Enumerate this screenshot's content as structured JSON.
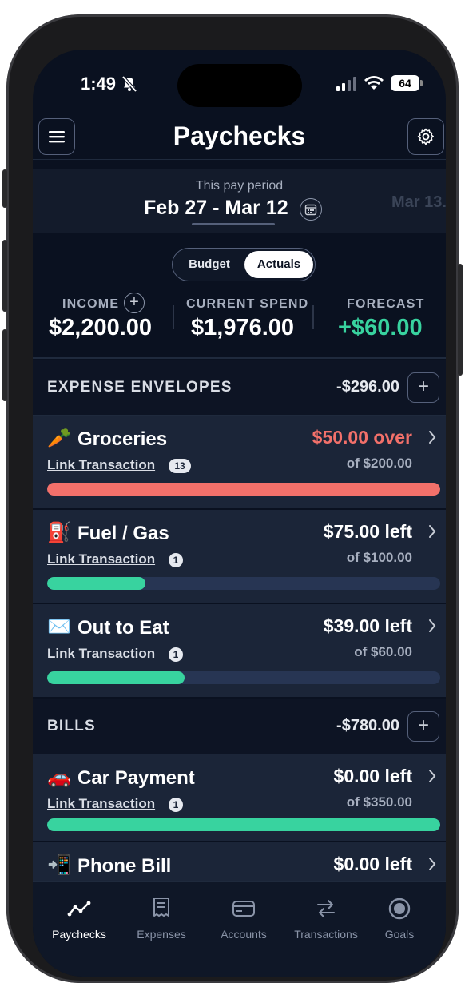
{
  "status_bar": {
    "time": "1:49",
    "battery": "64"
  },
  "header": {
    "title": "Paychecks"
  },
  "period": {
    "label": "This pay period",
    "dates": "Feb 27 - Mar 12",
    "next_preview": "Mar 13..."
  },
  "view_toggle": {
    "options": [
      "Budget",
      "Actuals"
    ],
    "selected": "Actuals"
  },
  "summary": {
    "income_label": "INCOME",
    "income_value": "$2,200.00",
    "spend_label": "CURRENT SPEND",
    "spend_value": "$1,976.00",
    "forecast_label": "FORECAST",
    "forecast_value": "+$60.00"
  },
  "expense_section": {
    "title": "EXPENSE ENVELOPES",
    "total": "-$296.00",
    "items": [
      {
        "icon": "carrot-icon",
        "emoji": "🥕",
        "name": "Groceries",
        "status": "$50.00 over",
        "of": "of $200.00",
        "link": "Link Transaction",
        "count": "13",
        "progress": 1.0,
        "state": "over"
      },
      {
        "icon": "fuel-pump-icon",
        "emoji": "⛽",
        "name": "Fuel / Gas",
        "status": "$75.00 left",
        "of": "of $100.00",
        "link": "Link Transaction",
        "count": "1",
        "progress": 0.25,
        "state": "ok"
      },
      {
        "icon": "envelope-icon",
        "emoji": "✉️",
        "name": "Out to Eat",
        "status": "$39.00 left",
        "of": "of $60.00",
        "link": "Link Transaction",
        "count": "1",
        "progress": 0.35,
        "state": "ok"
      }
    ]
  },
  "bills_section": {
    "title": "BILLS",
    "total": "-$780.00",
    "items": [
      {
        "icon": "car-icon",
        "emoji": "🚗",
        "name": "Car Payment",
        "status": "$0.00 left",
        "of": "of $350.00",
        "link": "Link Transaction",
        "count": "1",
        "progress": 1.0,
        "state": "ok"
      },
      {
        "icon": "phone-icon",
        "emoji": "📲",
        "name": "Phone Bill",
        "status": "$0.00 left"
      }
    ]
  },
  "tabs": [
    {
      "label": "Paychecks",
      "icon": "chart-line-icon",
      "active": true
    },
    {
      "label": "Expenses",
      "icon": "receipt-icon",
      "active": false
    },
    {
      "label": "Accounts",
      "icon": "card-icon",
      "active": false
    },
    {
      "label": "Transactions",
      "icon": "swap-arrows-icon",
      "active": false
    },
    {
      "label": "Goals",
      "icon": "target-icon",
      "active": false
    }
  ],
  "colors": {
    "over": "#f2706a",
    "ok": "#38d39f",
    "forecast": "#38d39f",
    "track": "#273553"
  }
}
